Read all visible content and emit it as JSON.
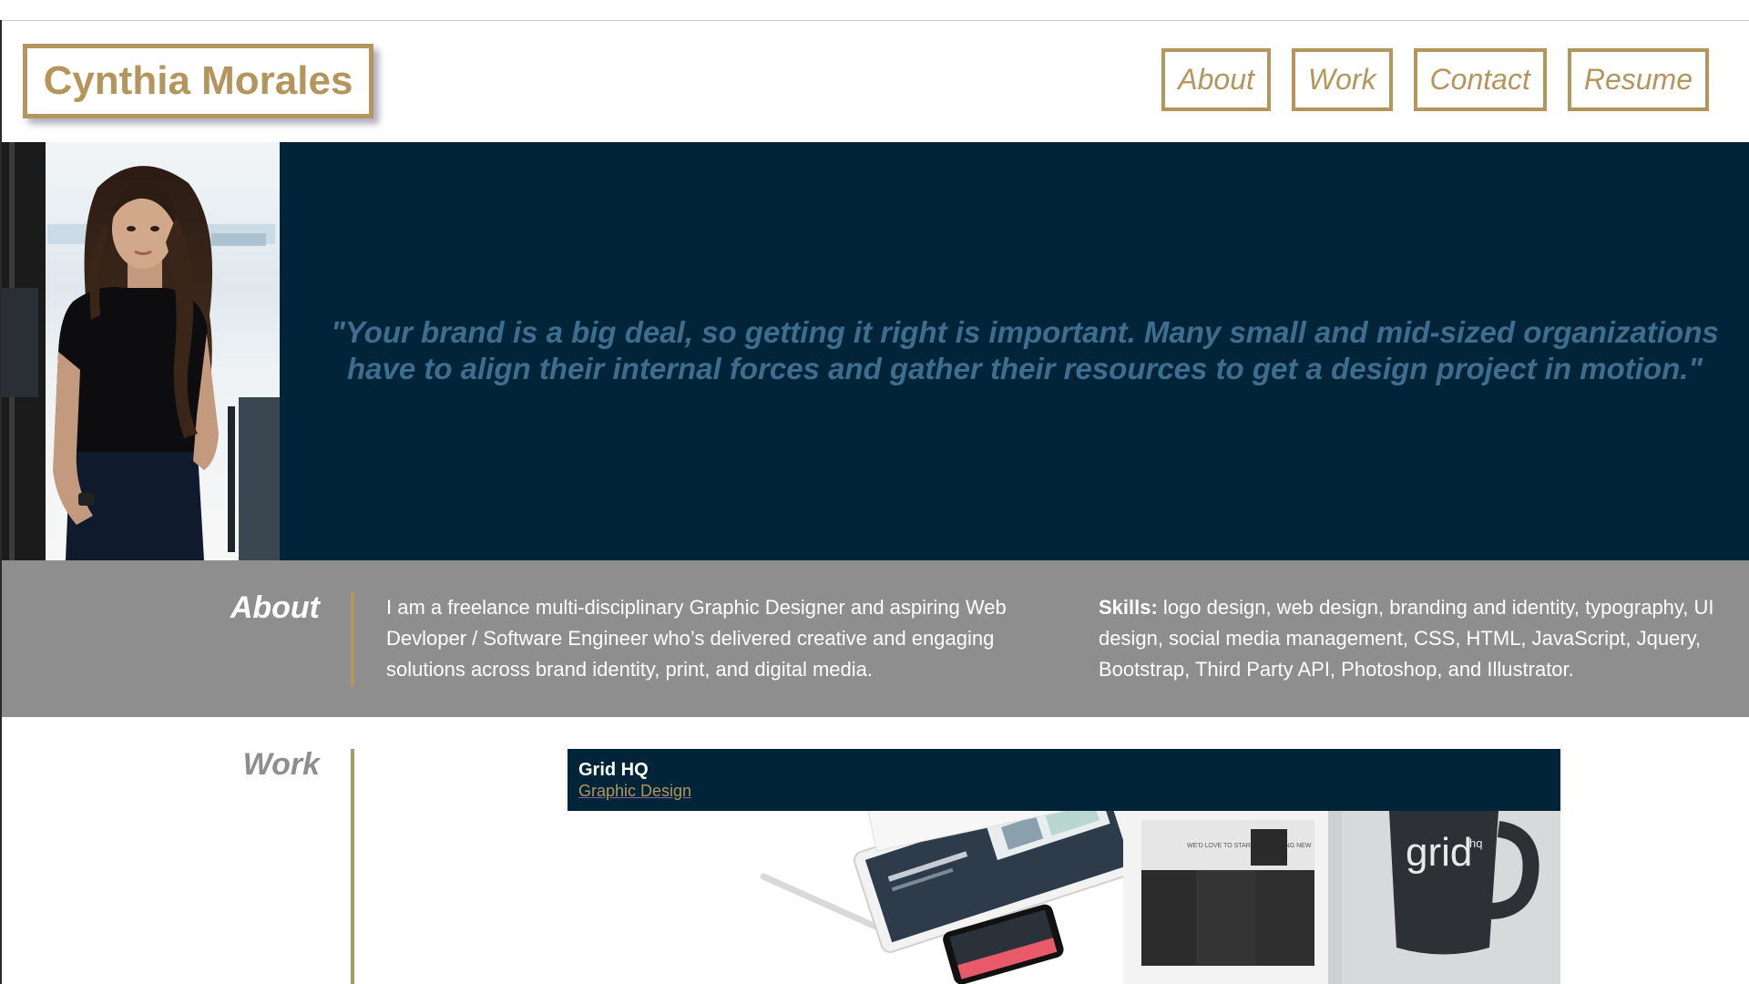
{
  "header": {
    "logo": "Cynthia Morales",
    "nav": [
      {
        "label": "About"
      },
      {
        "label": "Work"
      },
      {
        "label": "Contact"
      },
      {
        "label": "Resume"
      }
    ]
  },
  "hero": {
    "quote": "\"Your brand is a big deal, so getting it right is important. Many small and mid-sized organizations\nhave to align their internal forces and gather their resources to get a design project in motion.\""
  },
  "about": {
    "heading": "About",
    "bio": "I am a freelance multi-disciplinary Graphic Designer and aspiring Web Devloper / Software Engineer who’s delivered creative and engaging solutions across brand identity, print, and digital media.",
    "skills_label": "Skills:",
    "skills": " logo design, web design, branding and identity, typography, UI design, social media management, CSS, HTML, JavaScript, Jquery, Bootstrap, Third Party API, Photoshop, and Illustrator."
  },
  "work": {
    "heading": "Work",
    "projects": [
      {
        "title": "Grid HQ",
        "category": "Graphic Design",
        "mug_text": "grid",
        "mug_superscript": "hq",
        "mock_screen_text": "WE'D LOVE TO START SOMETHING NEW"
      }
    ]
  },
  "colors": {
    "accent_gold": "#b4955c",
    "navy": "#022438",
    "quote_blue": "#3e6e8e",
    "about_gray": "#8e8e8e"
  }
}
